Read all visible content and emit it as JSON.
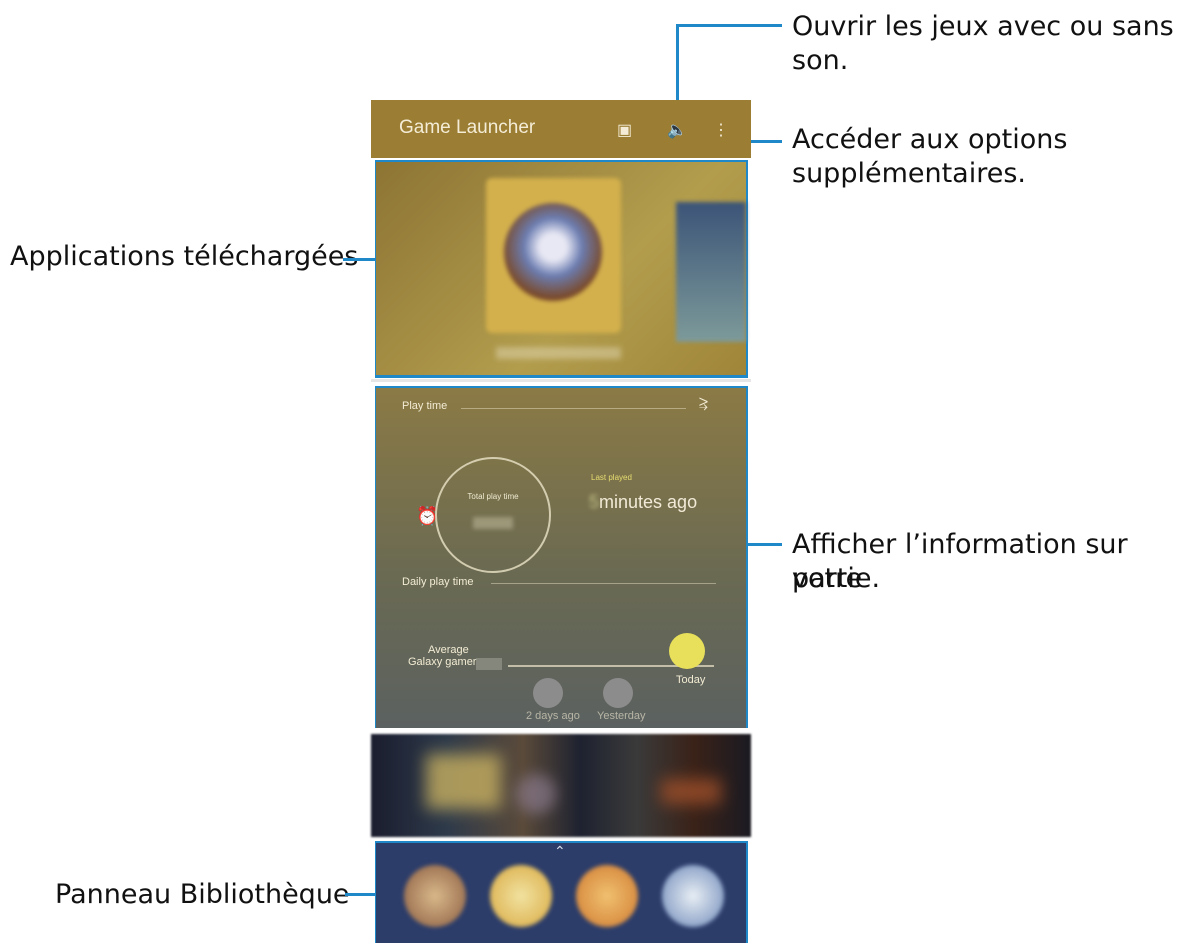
{
  "callouts": {
    "sound": "Ouvrir les jeux avec ou sans son.",
    "options_line1": "Accéder aux options",
    "options_line2": "supplémentaires.",
    "apps": "Applications téléchargées",
    "info_line1": "Afficher l’information sur votre",
    "info_line2": "partie.",
    "library": "Panneau Bibliothèque"
  },
  "appbar": {
    "title": "Game Launcher",
    "icons": [
      "chat-bubble-icon",
      "speaker-icon",
      "more-vert-icon"
    ]
  },
  "stats": {
    "play_time_label": "Play time",
    "total_play_time_label": "Total play time",
    "last_played_label": "Last played",
    "last_played_value": "minutes ago",
    "daily_label": "Daily play time",
    "average_label_line1": "Average",
    "average_label_line2": "Galaxy gamer",
    "today_label": "Today",
    "days_ago_label": "2 days ago",
    "yesterday_label": "Yesterday"
  },
  "colors": {
    "callout_line": "#1e88c8",
    "appbar": "#9b7e34",
    "today_dot": "#e8e05a",
    "library_bg": "#2c3d6a"
  }
}
